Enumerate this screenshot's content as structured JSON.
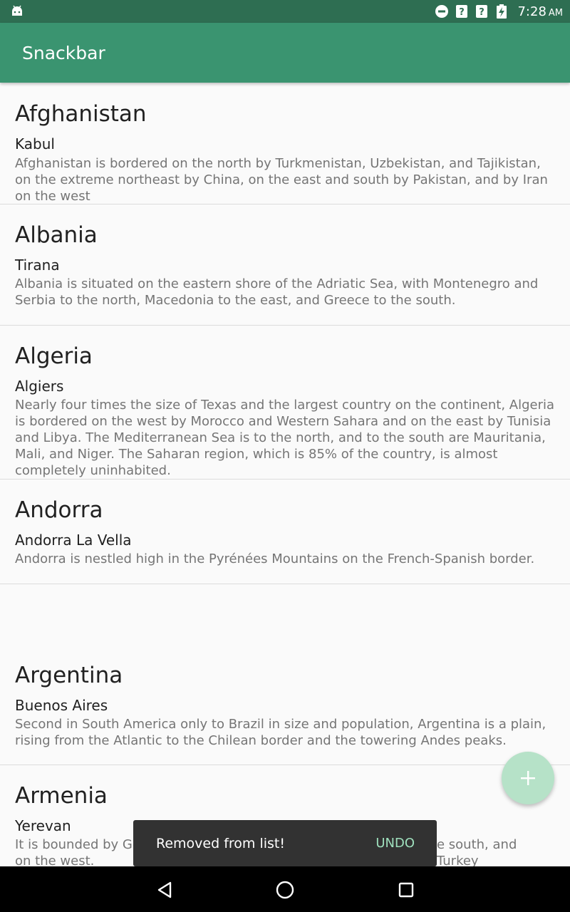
{
  "status_bar": {
    "time": "7:28",
    "ampm": "AM",
    "icons": [
      "android-icon",
      "do-not-disturb-icon",
      "no-wifi-icon",
      "no-signal-icon",
      "battery-charging-icon"
    ]
  },
  "app_bar": {
    "title": "Snackbar"
  },
  "items": [
    {
      "country": "Afghanistan",
      "capital": "Kabul",
      "description": "Afghanistan is bordered on the north by Turkmenistan, Uzbekistan, and Tajikistan, on the extreme northeast by China, on the east and south by Pakistan, and by Iran on the west"
    },
    {
      "country": "Albania",
      "capital": "Tirana",
      "description": "Albania is situated on the eastern shore of the Adriatic Sea, with Montenegro and Serbia to the north, Macedonia to the east, and Greece to the south."
    },
    {
      "country": "Algeria",
      "capital": "Algiers",
      "description": "Nearly four times the size of Texas and the largest country on the continent, Algeria is bordered on the west by Morocco and Western Sahara and on the east by Tunisia and Libya. The Mediterranean Sea is to the north, and to the south are Mauritania, Mali, and Niger. The Saharan region, which is 85% of the country, is almost completely uninhabited."
    },
    {
      "country": "Andorra",
      "capital": "Andorra La Vella",
      "description": "Andorra is nestled high in the Pyrénées Mountains on the French-Spanish border."
    },
    {
      "country": "Argentina",
      "capital": "Buenos Aires",
      "description": "Second in South America only to Brazil in size and population, Argentina is a plain, rising from the Atlantic to the Chilean border and the towering Andes peaks."
    },
    {
      "country": "Armenia",
      "capital": "Yerevan",
      "description": "It is bounded by Ge",
      "description_tail_1": "e south, and Turkey",
      "description_tail_2": "on the west."
    }
  ],
  "fab": {
    "icon": "plus-icon"
  },
  "snackbar": {
    "message": "Removed from list!",
    "action": "UNDO"
  },
  "nav_bar": {
    "icons": [
      "back-icon",
      "home-icon",
      "recents-icon"
    ]
  }
}
